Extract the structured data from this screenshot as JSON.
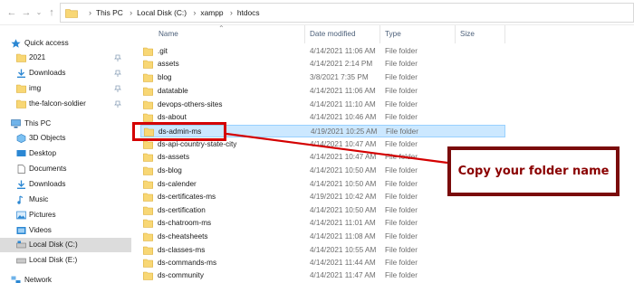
{
  "address": {
    "crumbs": [
      "This PC",
      "Local Disk (C:)",
      "xampp",
      "htdocs"
    ]
  },
  "nav": {
    "quick_access": "Quick access",
    "pinned": [
      "2021",
      "Downloads",
      "img",
      "the-falcon-soldier"
    ],
    "this_pc": "This PC",
    "pc_items": [
      "3D Objects",
      "Desktop",
      "Documents",
      "Downloads",
      "Music",
      "Pictures",
      "Videos",
      "Local Disk (C:)",
      "Local Disk (E:)"
    ],
    "network": "Network"
  },
  "columns": {
    "name": "Name",
    "date_modified": "Date modified",
    "type": "Type",
    "size": "Size"
  },
  "files": [
    {
      "name": ".git",
      "date": "4/14/2021 11:06 AM",
      "type": "File folder"
    },
    {
      "name": "assets",
      "date": "4/14/2021 2:14 PM",
      "type": "File folder"
    },
    {
      "name": "blog",
      "date": "3/8/2021 7:35 PM",
      "type": "File folder"
    },
    {
      "name": "datatable",
      "date": "4/14/2021 11:06 AM",
      "type": "File folder"
    },
    {
      "name": "devops-others-sites",
      "date": "4/14/2021 11:10 AM",
      "type": "File folder"
    },
    {
      "name": "ds-about",
      "date": "4/14/2021 10:46 AM",
      "type": "File folder"
    },
    {
      "name": "ds-admin-ms",
      "date": "4/19/2021 10:25 AM",
      "type": "File folder"
    },
    {
      "name": "ds-api-country-state-city",
      "date": "4/14/2021 10:47 AM",
      "type": "File folder"
    },
    {
      "name": "ds-assets",
      "date": "4/14/2021 10:47 AM",
      "type": "File folder"
    },
    {
      "name": "ds-blog",
      "date": "4/14/2021 10:50 AM",
      "type": "File folder"
    },
    {
      "name": "ds-calender",
      "date": "4/14/2021 10:50 AM",
      "type": "File folder"
    },
    {
      "name": "ds-certificates-ms",
      "date": "4/19/2021 10:42 AM",
      "type": "File folder"
    },
    {
      "name": "ds-certification",
      "date": "4/14/2021 10:50 AM",
      "type": "File folder"
    },
    {
      "name": "ds-chatroom-ms",
      "date": "4/14/2021 11:01 AM",
      "type": "File folder"
    },
    {
      "name": "ds-cheatsheets",
      "date": "4/14/2021 11:08 AM",
      "type": "File folder"
    },
    {
      "name": "ds-classes-ms",
      "date": "4/14/2021 10:55 AM",
      "type": "File folder"
    },
    {
      "name": "ds-commands-ms",
      "date": "4/14/2021 11:44 AM",
      "type": "File folder"
    },
    {
      "name": "ds-community",
      "date": "4/14/2021 11:47 AM",
      "type": "File folder"
    }
  ],
  "annotation": {
    "callout": "Copy your folder name"
  },
  "colors": {
    "folder": "#f8d775",
    "selection": "#cce8ff",
    "annotation_red": "#d40000",
    "callout_border": "#7a0b0b"
  }
}
